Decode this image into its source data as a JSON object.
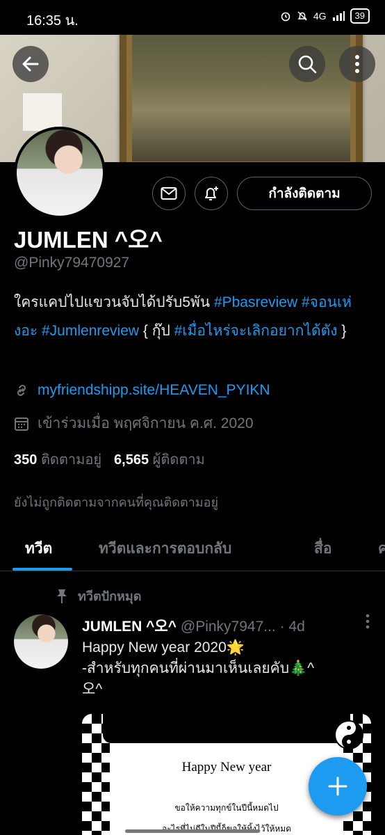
{
  "status_bar": {
    "time": "16:35 น.",
    "network": "4G",
    "battery": "39"
  },
  "header": {
    "back_icon": "arrow-left-icon",
    "search_icon": "search-icon",
    "more_icon": "vertical-dots-icon"
  },
  "profile": {
    "display_name": "JUMLEN ^오^",
    "handle": "@Pinky79470927",
    "follow_button_label": "กำลังติดตาม",
    "bio_plain_1": "ใครแคปไปแขวนจับได้ปรับ5พัน ",
    "bio_tag_1": "#Pbasreview",
    "bio_tag_2": "#จอนเห่งอะ",
    "bio_tag_3": "#Jumlenreview",
    "bio_plain_2": " { กุ๊ป ",
    "bio_tag_4": "#เมื่อไหร่จะเลิกอยากได้ตัง",
    "bio_plain_3": " }",
    "website": "myfriendshipp.site/HEAVEN_PYIKN",
    "joined": "เข้าร่วมเมื่อ พฤศจิกายน ค.ศ. 2020",
    "following_count": "350",
    "following_label": "ติดตามอยู่",
    "followers_count": "6,565",
    "followers_label": "ผู้ติดตาม",
    "not_followed_note": "ยังไม่ถูกติดตามจากคนที่คุณติดตามอยู่"
  },
  "tabs": [
    "ทวีต",
    "ทวีตและการตอบกลับ",
    "สื่อ",
    "ค"
  ],
  "tweet": {
    "pinned_label": "ทวีตปักหมุด",
    "author_name": "JUMLEN ^오^",
    "author_handle": "@Pinky7947...",
    "time": "· 4d",
    "line1": "Happy New year 2020🌟",
    "line2": "-สำหรับทุกคนที่ผ่านมาเห็นเลยคับ🎄^",
    "line3": "오^",
    "media_title": "Happy New year",
    "media_line1": "ขอให้ความทุกข์ในปีนี้หมดไป",
    "media_line2": "อะไรที่ไม่ดีในปีนี้ก็ขอให้ทิ้งไว้ให้หมด"
  },
  "colors": {
    "accent": "#1d9bf0",
    "background": "#000000",
    "muted": "#71767b"
  }
}
